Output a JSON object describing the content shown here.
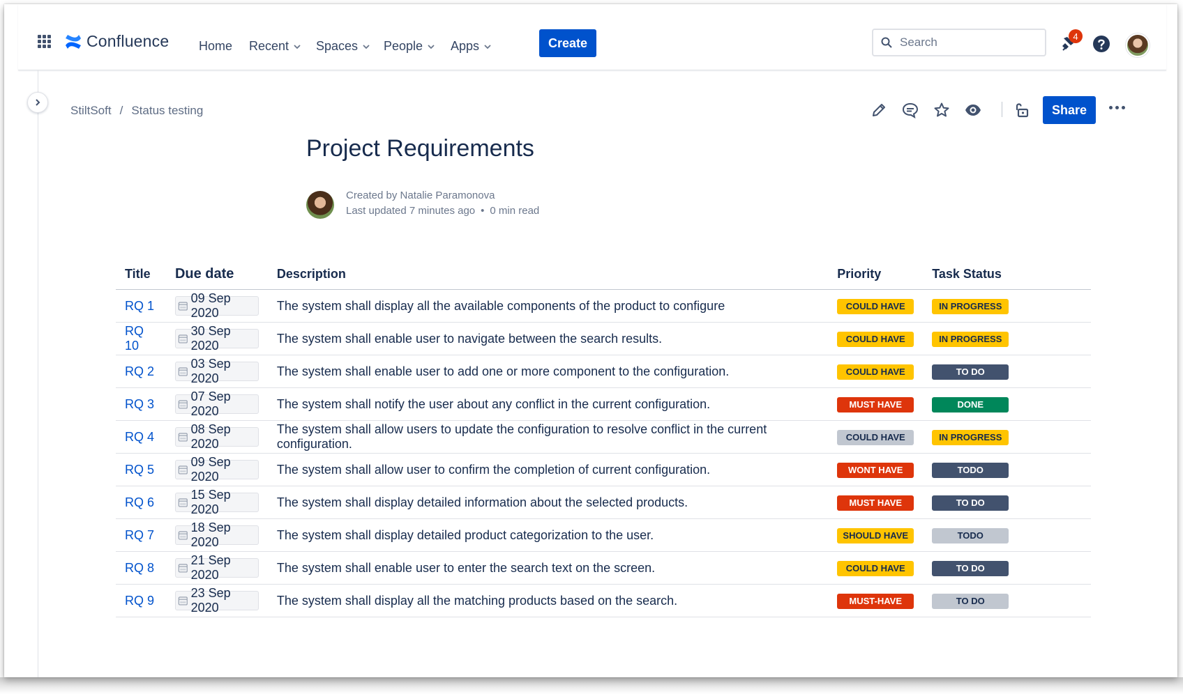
{
  "topnav": {
    "brand": "Confluence",
    "items": [
      {
        "label": "Home",
        "has_dropdown": false
      },
      {
        "label": "Recent",
        "has_dropdown": true
      },
      {
        "label": "Spaces",
        "has_dropdown": true
      },
      {
        "label": "People",
        "has_dropdown": true
      },
      {
        "label": "Apps",
        "has_dropdown": true
      }
    ],
    "create_label": "Create",
    "search_placeholder": "Search",
    "notification_count": "4"
  },
  "breadcrumb": {
    "space": "StiltSoft",
    "separator": "/",
    "page": "Status testing"
  },
  "toolbar": {
    "share_label": "Share",
    "icons": [
      "edit-icon",
      "comment-icon",
      "star-icon",
      "watch-icon",
      "restrictions-icon",
      "more-icon"
    ]
  },
  "page": {
    "title": "Project Requirements",
    "created_by": "Created by Natalie Paramonova",
    "last_updated": "Last updated 7 minutes ago",
    "dot": "•",
    "read_time": "0 min read"
  },
  "table": {
    "headers": {
      "title": "Title",
      "due": "Due date",
      "description": "Description",
      "priority": "Priority",
      "status": "Task Status"
    },
    "rows": [
      {
        "title": "RQ 1",
        "due": "09 Sep 2020",
        "description": "The system shall display all the available components of the product to configure",
        "priority": "COULD HAVE",
        "priority_color": "yellow",
        "status": "IN PROGRESS",
        "status_color": "yellow"
      },
      {
        "title": "RQ 10",
        "due": "30 Sep 2020",
        "description": "The system shall enable user to navigate between the search results.",
        "priority": "COULD HAVE",
        "priority_color": "yellow",
        "status": "IN PROGRESS",
        "status_color": "yellow"
      },
      {
        "title": "RQ 2",
        "due": "03 Sep 2020",
        "description": "The system shall enable user to add one or more component to the configuration.",
        "priority": "COULD HAVE",
        "priority_color": "yellow",
        "status": "TO DO",
        "status_color": "blue"
      },
      {
        "title": "RQ 3",
        "due": "07 Sep 2020",
        "description": "The system shall notify the user about any conflict in the current configuration.",
        "priority": "MUST HAVE",
        "priority_color": "red",
        "status": "DONE",
        "status_color": "green"
      },
      {
        "title": "RQ 4",
        "due": "08 Sep 2020",
        "description": "The system shall allow users to update the configuration to resolve conflict in the current configuration.",
        "priority": "COULD HAVE",
        "priority_color": "grey",
        "status": "IN PROGRESS",
        "status_color": "yellow"
      },
      {
        "title": "RQ 5",
        "due": "09 Sep 2020",
        "description": "The system shall allow user to confirm the completion of current configuration.",
        "priority": "WONT HAVE",
        "priority_color": "red",
        "status": "TODO",
        "status_color": "blue"
      },
      {
        "title": "RQ 6",
        "due": "15 Sep 2020",
        "description": "The system shall display detailed information about the selected products.",
        "priority": "MUST HAVE",
        "priority_color": "red",
        "status": "TO DO",
        "status_color": "blue"
      },
      {
        "title": "RQ 7",
        "due": "18 Sep 2020",
        "description": "The system shall display detailed product categorization to the user.",
        "priority": "SHOULD HAVE",
        "priority_color": "yellow",
        "status": "TODO",
        "status_color": "grey"
      },
      {
        "title": "RQ 8",
        "due": "21 Sep 2020",
        "description": "The system shall enable user to enter the search text on the screen.",
        "priority": "COULD HAVE",
        "priority_color": "yellow",
        "status": "TO DO",
        "status_color": "blue"
      },
      {
        "title": "RQ 9",
        "due": "23 Sep 2020",
        "description": "The system shall display all the matching products based on the search.",
        "priority": "MUST-HAVE",
        "priority_color": "red",
        "status": "TO DO",
        "status_color": "grey"
      }
    ]
  },
  "colors": {
    "accent": "#0052cc",
    "link": "#0052cc",
    "lozenge": {
      "yellow": {
        "bg": "#ffc400",
        "fg": "#172b4d"
      },
      "red": {
        "bg": "#de350b",
        "fg": "#ffffff"
      },
      "blue": {
        "bg": "#42526e",
        "fg": "#ffffff"
      },
      "green": {
        "bg": "#00875a",
        "fg": "#ffffff"
      },
      "grey": {
        "bg": "#c1c7d0",
        "fg": "#172b4d"
      }
    }
  }
}
